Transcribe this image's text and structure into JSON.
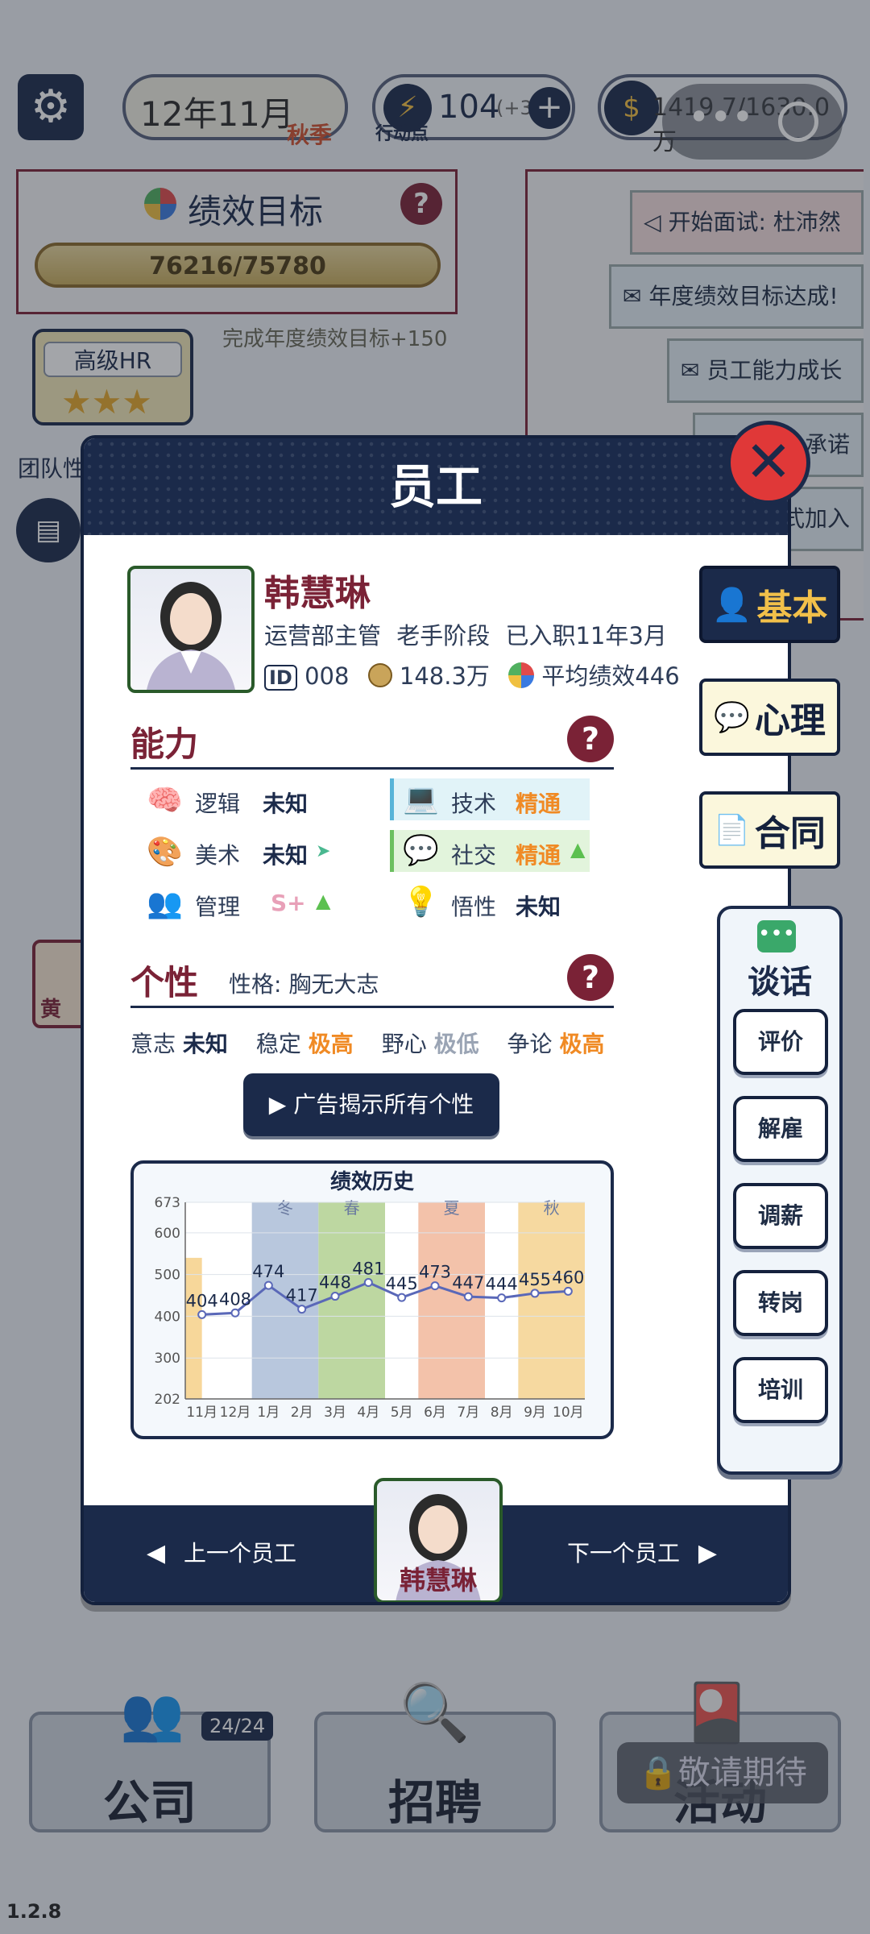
{
  "top_bar": {
    "date": "12年11月",
    "season": "秋季",
    "action_points": "104",
    "action_points_bonus": "(+3",
    "action_points_label": "行动点",
    "money": "1419.7/1630.0万"
  },
  "goal_panel": {
    "title": "绩效目标",
    "progress_text": "76216/75780",
    "progress_fraction": 1.0,
    "reward_text": "完成年度绩效目标+150",
    "rank_label": "高级HR",
    "rank_stars": 3
  },
  "notifications": [
    "开始面试: 杜沛然",
    "年度绩效目标达成!",
    "员工能力成长",
    "承诺",
    "式加入"
  ],
  "background_labels": {
    "team": "团队性",
    "npc": "黄"
  },
  "modal": {
    "title": "员工",
    "employee": {
      "name": "韩慧琳",
      "role": "运营部主管",
      "stage": "老手阶段",
      "tenure": "已入职11年3月",
      "id_label": "ID",
      "id": "008",
      "salary": "148.3万",
      "avg_perf": "平均绩效446"
    },
    "ability": {
      "title": "能力",
      "items": [
        {
          "label": "逻辑",
          "value": "未知"
        },
        {
          "label": "技术",
          "value": "精通"
        },
        {
          "label": "美术",
          "value": "未知"
        },
        {
          "label": "社交",
          "value": "精通"
        },
        {
          "label": "管理",
          "value": "S+"
        },
        {
          "label": "悟性",
          "value": "未知"
        }
      ]
    },
    "personality": {
      "title": "个性",
      "type_text": "性格: 胸无大志",
      "traits": [
        {
          "label": "意志",
          "value": "未知"
        },
        {
          "label": "稳定",
          "value": "极高"
        },
        {
          "label": "野心",
          "value": "极低"
        },
        {
          "label": "争论",
          "value": "极高"
        }
      ],
      "ad_button": "广告揭示所有个性"
    },
    "footer": {
      "prev": "上一个员工",
      "next": "下一个员工",
      "name": "韩慧琳"
    }
  },
  "side_tabs": [
    "基本",
    "心理",
    "合同"
  ],
  "talk": {
    "title": "谈话",
    "buttons": [
      "评价",
      "解雇",
      "调薪",
      "转岗",
      "培训"
    ]
  },
  "bottom_nav": {
    "company": "公司",
    "company_count": "24/24",
    "recruit": "招聘",
    "activity": "活动",
    "locked": "敬请期待"
  },
  "version": "1.2.8",
  "chart_data": {
    "type": "line",
    "title": "绩效历史",
    "categories": [
      "11月",
      "12月",
      "1月",
      "2月",
      "3月",
      "4月",
      "5月",
      "6月",
      "7月",
      "8月",
      "9月",
      "10月"
    ],
    "series": [
      {
        "values": [
          404,
          408,
          474,
          417,
          448,
          481,
          445,
          473,
          447,
          444,
          455,
          460
        ]
      }
    ],
    "ylim": [
      202,
      673
    ],
    "yticks": [
      202,
      300,
      400,
      500,
      600,
      673
    ],
    "season_bands": [
      {
        "label": "",
        "from": 0,
        "to": 0,
        "color": "#f7d79a"
      },
      {
        "label": "冬",
        "from": 2,
        "to": 3,
        "color": "#b8c7dd"
      },
      {
        "label": "春",
        "from": 4,
        "to": 5,
        "color": "#bdd7a1"
      },
      {
        "label": "夏",
        "from": 7,
        "to": 8,
        "color": "#f3c2aa"
      },
      {
        "label": "秋",
        "from": 10,
        "to": 11,
        "color": "#f6d9a0"
      }
    ],
    "line_color": "#5a68b8",
    "grid": true
  }
}
